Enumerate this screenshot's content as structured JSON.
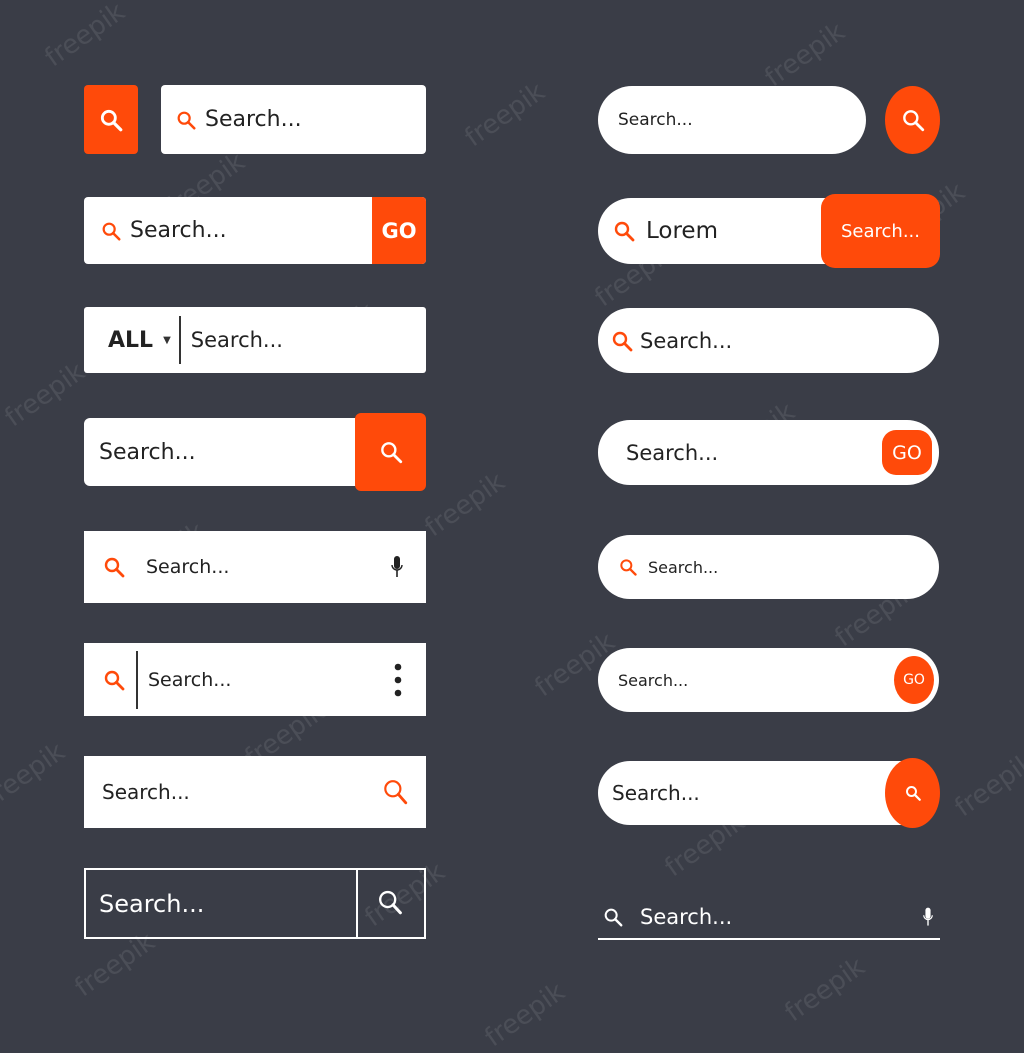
{
  "theme": {
    "background": "#3a3d47",
    "accent": "#ff4a0a",
    "bar": "#ffffff"
  },
  "watermark": "freepik",
  "search_placeholder": "Search...",
  "left": {
    "go_label": "GO",
    "category_label": "ALL"
  },
  "right": {
    "lorem_value": "Lorem",
    "search_button_label": "Search...",
    "go_label": "GO"
  }
}
